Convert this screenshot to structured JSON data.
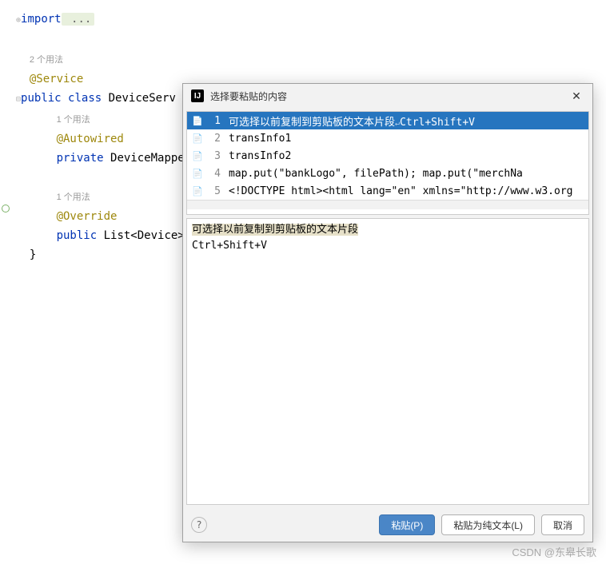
{
  "code": {
    "import_kw": "import",
    "import_rest": " ...",
    "usage_2": "2 个用法",
    "ann_service": "@Service",
    "class_decl_kw": "public class",
    "class_decl_name": " DeviceServ",
    "usage_1a": "1 个用法",
    "ann_autowired": "@Autowired",
    "field_kw": "private",
    "field_rest": " DeviceMappe",
    "usage_1b": "1 个用法",
    "ann_override": "@Override",
    "method_kw": "public",
    "method_rest": " List<Device>",
    "close_brace": "}"
  },
  "dialog": {
    "title": "选择要粘贴的内容",
    "items": [
      {
        "num": "1",
        "text": "可选择以前复制到剪贴板的文本片段",
        "shortcut": "Ctrl+Shift+V",
        "selected": true
      },
      {
        "num": "2",
        "text": "transInfo1"
      },
      {
        "num": "3",
        "text": "transInfo2"
      },
      {
        "num": "4",
        "text": " map.put(\"bankLogo\", filePath);          map.put(\"merchNa"
      },
      {
        "num": "5",
        "text": "<!DOCTYPE html><html lang=\"en\" xmlns=\"http://www.w3.org"
      }
    ],
    "preview_line1": "可选择以前复制到剪贴板的文本片段",
    "preview_line2": "Ctrl+Shift+V",
    "btn_paste": "粘贴(P)",
    "btn_plain": "粘贴为纯文本(L)",
    "btn_cancel": "取消"
  },
  "watermark": "CSDN @东皋长歌"
}
